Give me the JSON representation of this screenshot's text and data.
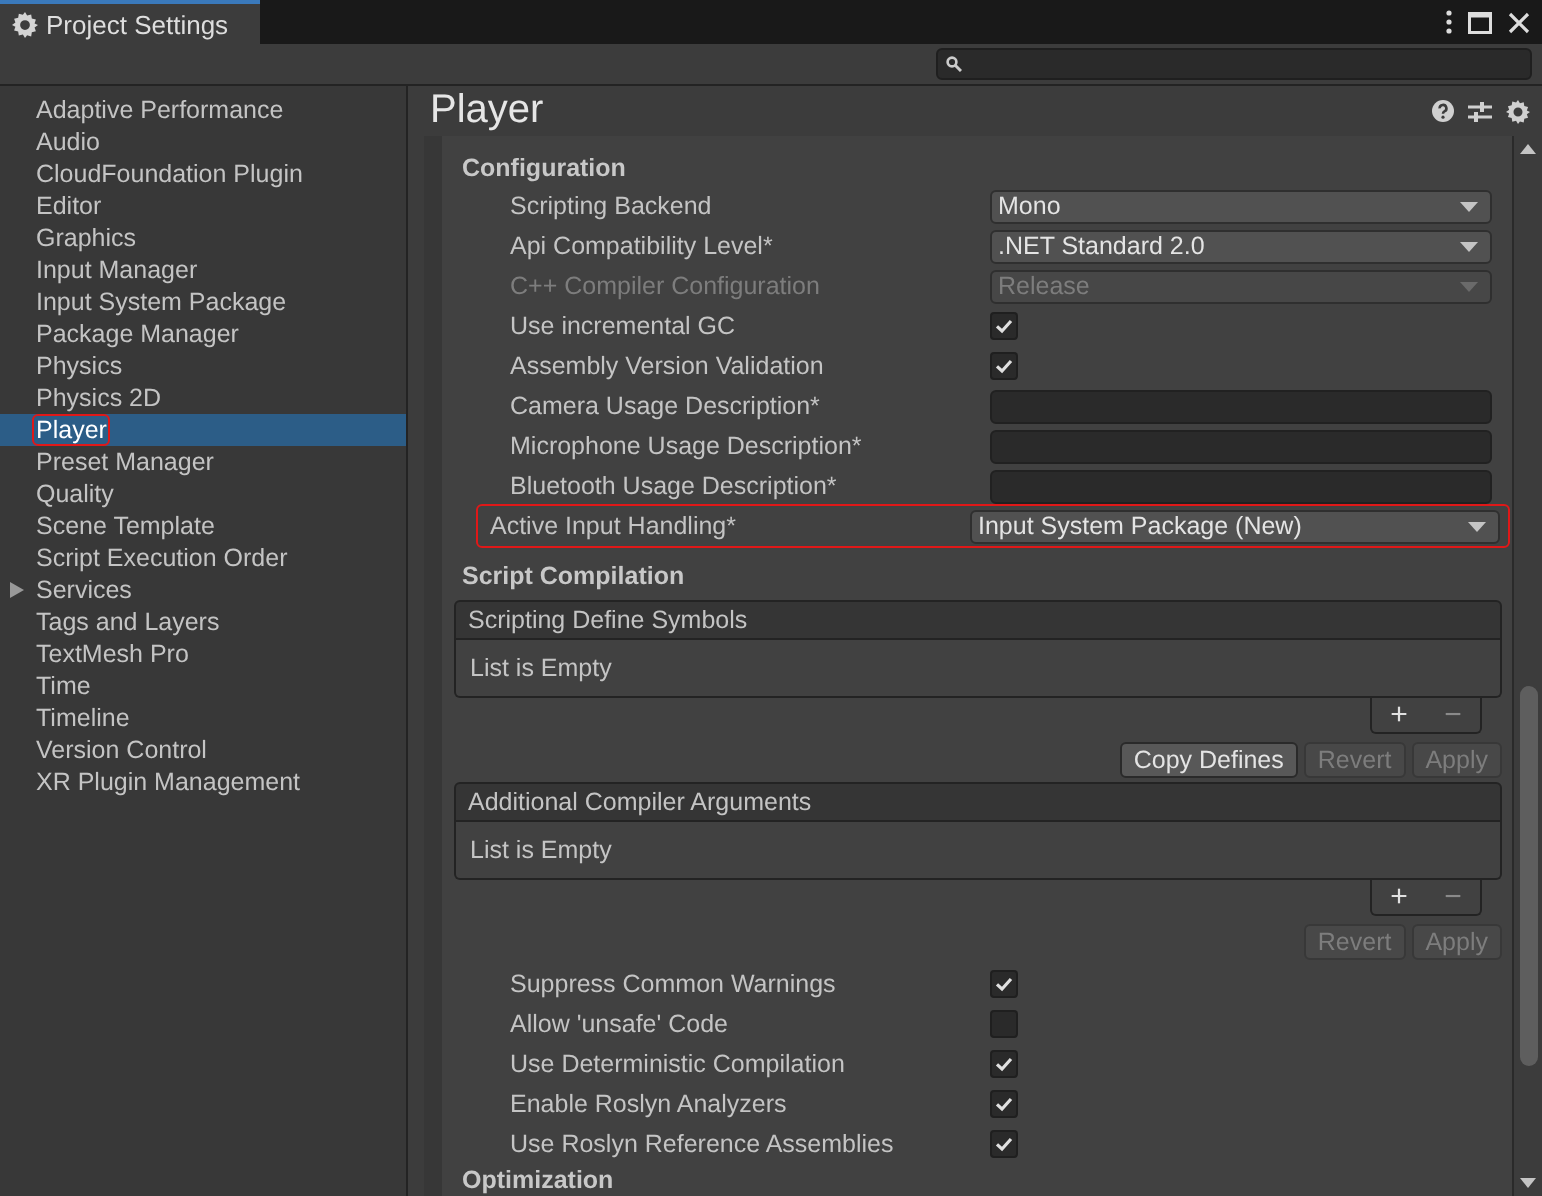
{
  "window": {
    "title": "Project Settings"
  },
  "sidebar": {
    "items": [
      {
        "label": "Adaptive Performance",
        "kind": "page",
        "selected": false,
        "highlighted": false
      },
      {
        "label": "Audio",
        "kind": "page",
        "selected": false,
        "highlighted": false
      },
      {
        "label": "CloudFoundation Plugin",
        "kind": "page",
        "selected": false,
        "highlighted": false
      },
      {
        "label": "Editor",
        "kind": "page",
        "selected": false,
        "highlighted": false
      },
      {
        "label": "Graphics",
        "kind": "page",
        "selected": false,
        "highlighted": false
      },
      {
        "label": "Input Manager",
        "kind": "page",
        "selected": false,
        "highlighted": false
      },
      {
        "label": "Input System Package",
        "kind": "page",
        "selected": false,
        "highlighted": false
      },
      {
        "label": "Package Manager",
        "kind": "page",
        "selected": false,
        "highlighted": false
      },
      {
        "label": "Physics",
        "kind": "page",
        "selected": false,
        "highlighted": false
      },
      {
        "label": "Physics 2D",
        "kind": "page",
        "selected": false,
        "highlighted": false
      },
      {
        "label": "Player",
        "kind": "page",
        "selected": true,
        "highlighted": true
      },
      {
        "label": "Preset Manager",
        "kind": "page",
        "selected": false,
        "highlighted": false
      },
      {
        "label": "Quality",
        "kind": "page",
        "selected": false,
        "highlighted": false
      },
      {
        "label": "Scene Template",
        "kind": "page",
        "selected": false,
        "highlighted": false
      },
      {
        "label": "Script Execution Order",
        "kind": "page",
        "selected": false,
        "highlighted": false
      },
      {
        "label": "Services",
        "kind": "group",
        "selected": false,
        "highlighted": false
      },
      {
        "label": "Tags and Layers",
        "kind": "page",
        "selected": false,
        "highlighted": false
      },
      {
        "label": "TextMesh Pro",
        "kind": "page",
        "selected": false,
        "highlighted": false
      },
      {
        "label": "Time",
        "kind": "page",
        "selected": false,
        "highlighted": false
      },
      {
        "label": "Timeline",
        "kind": "page",
        "selected": false,
        "highlighted": false
      },
      {
        "label": "Version Control",
        "kind": "page",
        "selected": false,
        "highlighted": false
      },
      {
        "label": "XR Plugin Management",
        "kind": "page",
        "selected": false,
        "highlighted": false
      }
    ]
  },
  "page": {
    "title": "Player"
  },
  "configuration": {
    "title": "Configuration",
    "rows": [
      {
        "label": "Scripting Backend",
        "kind": "dropdown",
        "value": "Mono",
        "disabled": false,
        "highlighted": false
      },
      {
        "label": "Api Compatibility Level*",
        "kind": "dropdown",
        "value": ".NET Standard 2.0",
        "disabled": false,
        "highlighted": false
      },
      {
        "label": "C++ Compiler Configuration",
        "kind": "dropdown",
        "value": "Release",
        "disabled": true,
        "highlighted": false
      },
      {
        "label": "Use incremental GC",
        "kind": "checkbox",
        "checked": true,
        "disabled": false,
        "highlighted": false
      },
      {
        "label": "Assembly Version Validation",
        "kind": "checkbox",
        "checked": true,
        "disabled": false,
        "highlighted": false
      },
      {
        "label": "Camera Usage Description*",
        "kind": "text",
        "disabled": false,
        "highlighted": false
      },
      {
        "label": "Microphone Usage Description*",
        "kind": "text",
        "disabled": false,
        "highlighted": false
      },
      {
        "label": "Bluetooth Usage Description*",
        "kind": "text",
        "disabled": false,
        "highlighted": false
      },
      {
        "label": "Active Input Handling*",
        "kind": "dropdown",
        "value": "Input System Package (New)",
        "disabled": false,
        "highlighted": true
      }
    ]
  },
  "script_compilation": {
    "title": "Script Compilation",
    "lists": [
      {
        "title": "Scripting Define Symbols",
        "empty_text": "List is Empty",
        "add": "+",
        "remove": "−",
        "buttons": [
          {
            "label": "Copy Defines",
            "disabled": false
          },
          {
            "label": "Revert",
            "disabled": true
          },
          {
            "label": "Apply",
            "disabled": true
          }
        ]
      },
      {
        "title": "Additional Compiler Arguments",
        "empty_text": "List is Empty",
        "add": "+",
        "remove": "−",
        "buttons": [
          {
            "label": "Revert",
            "disabled": true
          },
          {
            "label": "Apply",
            "disabled": true
          }
        ]
      }
    ],
    "rows": [
      {
        "label": "Suppress Common Warnings",
        "checked": true
      },
      {
        "label": "Allow 'unsafe' Code",
        "checked": false
      },
      {
        "label": "Use Deterministic Compilation",
        "checked": true
      },
      {
        "label": "Enable Roslyn Analyzers",
        "checked": true
      },
      {
        "label": "Use Roslyn Reference Assemblies",
        "checked": true
      }
    ]
  },
  "optimization": {
    "title": "Optimization"
  }
}
